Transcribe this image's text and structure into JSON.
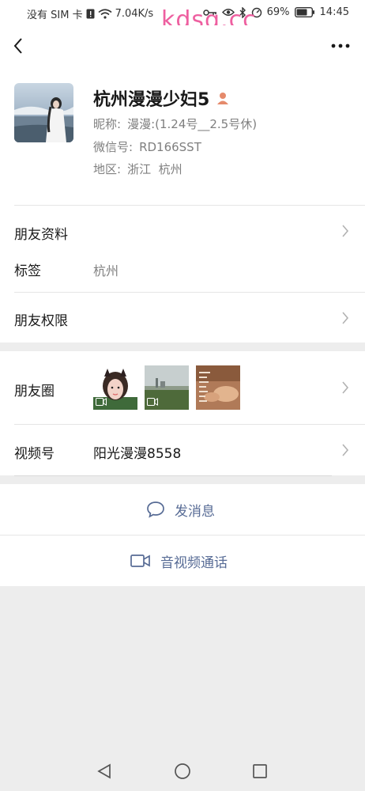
{
  "status_bar": {
    "carrier": "没有 SIM 卡",
    "speed": "7.04K/s",
    "battery": "69%",
    "time": "14:45"
  },
  "watermark": "kdsq.cc",
  "profile": {
    "name": "杭州漫漫少妇5",
    "nickname_label": "昵称:",
    "nickname_value": "漫漫:(1.24号__2.5号休)",
    "wechat_id_label": "微信号:",
    "wechat_id_value": "RD166SST",
    "region_label": "地区:",
    "region_value": "浙江  杭州"
  },
  "friend_info": {
    "label": "朋友资料"
  },
  "tags": {
    "label": "标签",
    "value": "杭州"
  },
  "permissions": {
    "label": "朋友权限"
  },
  "moments": {
    "label": "朋友圈"
  },
  "channels": {
    "label": "视频号",
    "value": "阳光漫漫8558"
  },
  "actions": {
    "message": "发消息",
    "call": "音视频通话"
  },
  "colors": {
    "link_blue": "#576b95",
    "background": "#ededed",
    "watermark_pink": "#ee5fa0"
  }
}
